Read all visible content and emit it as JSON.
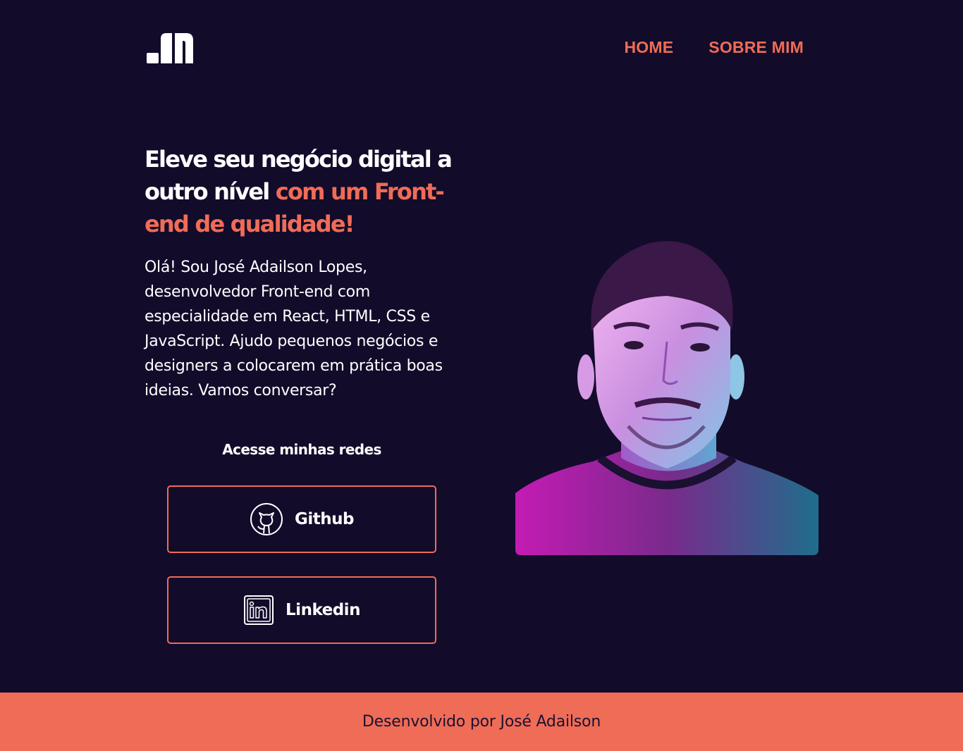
{
  "brand": {
    "logo_icon": "brand-logo-icon"
  },
  "nav": {
    "items": [
      {
        "label": "HOME"
      },
      {
        "label": "SOBRE MIM"
      }
    ],
    "color": "#ef6c57"
  },
  "hero": {
    "headline_white": "Eleve seu negócio digital a outro nível",
    "headline_accent": "com um Front-end de qualidade!",
    "intro": "Olá! Sou José Adailson Lopes, desenvolvedor Front-end com especialidade em React, HTML, CSS e JavaScript. Ajudo pequenos negócios e designers a colocarem em prática boas ideias. Vamos conversar?",
    "social_title": "Acesse minhas redes",
    "buttons": [
      {
        "label": "Github",
        "icon": "github-icon"
      },
      {
        "label": "Linkedin",
        "icon": "linkedin-icon"
      }
    ],
    "portrait": "profile-photo"
  },
  "footer": {
    "text": "Desenvolvido por José Adailson"
  },
  "colors": {
    "background": "#130b2a",
    "accent": "#ef6c57",
    "text": "#ffffff",
    "footer_text": "#1a1230"
  }
}
